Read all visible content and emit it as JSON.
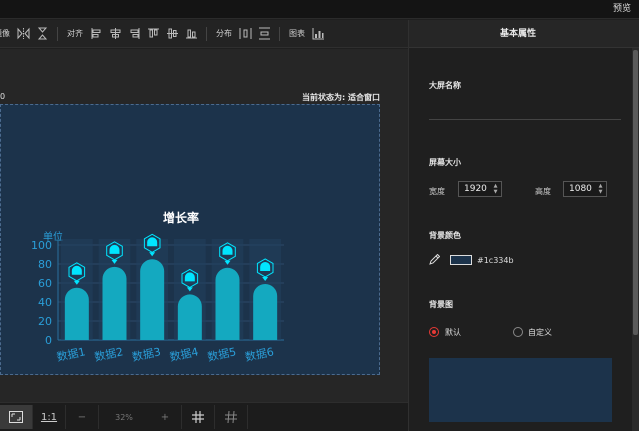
{
  "topbar": {
    "preview_label": "预览"
  },
  "toolbar": {
    "mirror_label": "镜像",
    "align_label": "对齐",
    "distribute_label": "分布",
    "chart_label": "图表"
  },
  "canvas": {
    "status_left": "0",
    "status_prefix": "当前状态为:",
    "status_value": "适合窗口",
    "screen_bg": "#1c334b"
  },
  "chart_data": {
    "type": "bar",
    "title": "增长率",
    "ylabel": "单位",
    "categories": [
      "数据1",
      "数据2",
      "数据3",
      "数据4",
      "数据5",
      "数据6"
    ],
    "values": [
      55,
      77,
      85,
      48,
      76,
      59
    ],
    "ylim": [
      0,
      100
    ],
    "yticks": [
      0,
      20,
      40,
      60,
      80,
      100
    ],
    "bar_color": "#14a9c0",
    "marker_color": "#00e5ff",
    "label_color": "#2a9ed8"
  },
  "bottombar": {
    "ratio_label": "1:1",
    "minus_label": "−",
    "zoom": "32%",
    "plus_label": "+"
  },
  "panel": {
    "header": "基本属性",
    "screen_name_label": "大屏名称",
    "screen_size_label": "屏幕大小",
    "width_label": "宽度",
    "width_value": "1920",
    "height_label": "高度",
    "height_value": "1080",
    "bg_color_label": "背景颜色",
    "bg_color_value": "#1c334b",
    "bg_image_label": "背景图",
    "radio_default": "默认",
    "radio_custom": "自定义"
  }
}
